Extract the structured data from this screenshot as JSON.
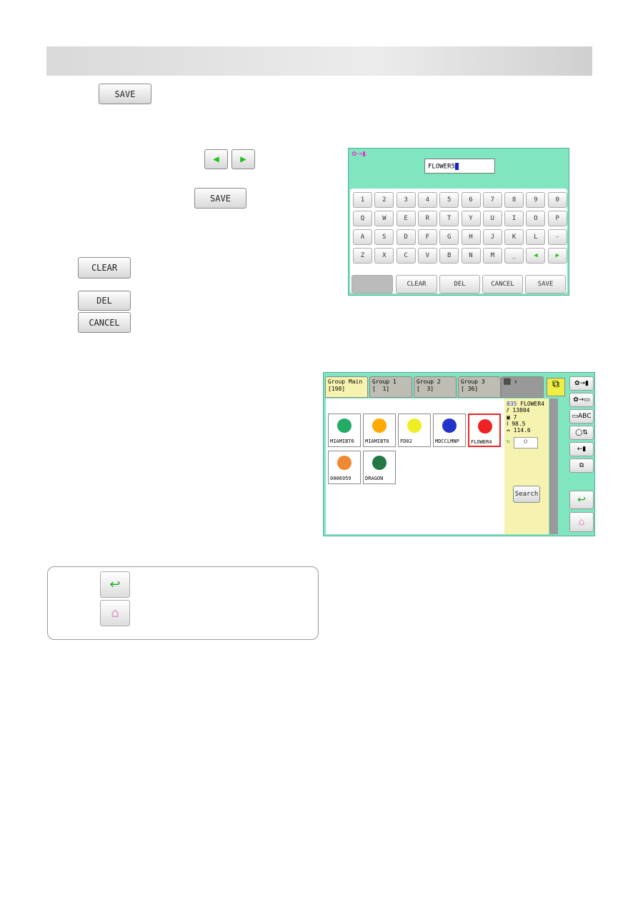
{
  "buttons": {
    "save": "SAVE",
    "clear": "CLEAR",
    "del": "DEL",
    "cancel": "CANCEL",
    "left_arrow": "◀",
    "right_arrow": "▶"
  },
  "keyboard_screen": {
    "input_value": "FLOWER5",
    "rows": [
      [
        "1",
        "2",
        "3",
        "4",
        "5",
        "6",
        "7",
        "8",
        "9",
        "0"
      ],
      [
        "Q",
        "W",
        "E",
        "R",
        "T",
        "Y",
        "U",
        "I",
        "O",
        "P"
      ],
      [
        "A",
        "S",
        "D",
        "F",
        "G",
        "H",
        "J",
        "K",
        "L",
        "-"
      ],
      [
        "Z",
        "X",
        "C",
        "V",
        "B",
        "N",
        "M",
        "_",
        "◀",
        "▶"
      ]
    ],
    "bottom": [
      "",
      "CLEAR",
      "DEL",
      "CANCEL",
      "SAVE"
    ]
  },
  "design_screen": {
    "tabs": [
      "Group Main\n[198]",
      "Group 1\n[  1]",
      "Group 2\n[  3]",
      "Group 3\n[ 36]"
    ],
    "designs": [
      "MIAMIBT6",
      "MIAMIBT6",
      "FD02",
      "MDCCLMNP",
      "FLOWER4",
      "0006959",
      "DRAGON"
    ],
    "selected": "FLOWER4",
    "info": {
      "number": "035",
      "name": "FLOWER4",
      "stitches": "13804",
      "colors": "7",
      "height": "98.5",
      "width": "114.6"
    },
    "search": "Search"
  },
  "icons": [
    "back-icon",
    "home-icon"
  ]
}
